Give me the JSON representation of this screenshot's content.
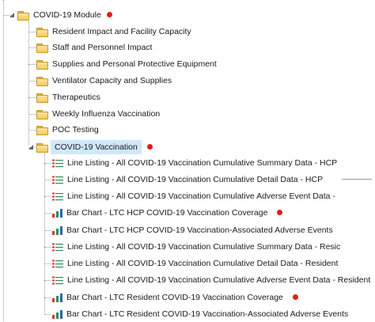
{
  "tree": {
    "module": {
      "label": "COVID-19 Module",
      "has_alert": true
    },
    "folders": [
      {
        "label": "Resident Impact and Facility Capacity"
      },
      {
        "label": "Staff and Personnel Impact"
      },
      {
        "label": "Supplies and Personal Protective Equipment"
      },
      {
        "label": "Ventilator Capacity and Supplies"
      },
      {
        "label": "Therapeutics"
      },
      {
        "label": "Weekly Influenza Vaccination"
      },
      {
        "label": "POC Testing"
      }
    ],
    "vaccination": {
      "label": "COVID-19 Vaccination",
      "has_alert": true,
      "selected": true,
      "reports": [
        {
          "type": "list-icon",
          "label": "Line Listing - All COVID-19 Vaccination Cumulative Summary Data - HCP",
          "has_alert": false
        },
        {
          "type": "list-icon",
          "label": "Line Listing - All COVID-19 Vaccination Cumulative Detail Data - HCP",
          "has_alert": false
        },
        {
          "type": "list-icon",
          "label": "Line Listing - All COVID-19 Vaccination Cumulative Adverse Event Data -",
          "has_alert": false
        },
        {
          "type": "bar-chart-icon",
          "label": "Bar Chart - LTC HCP COVID-19 Vaccination Coverage",
          "has_alert": true
        },
        {
          "type": "bar-chart-icon",
          "label": "Bar Chart - LTC HCP COVID-19 Vaccination-Associated Adverse Events",
          "has_alert": false
        },
        {
          "type": "list-icon",
          "label": "Line Listing - All COVID-19 Vaccination Cumulative Summary Data - Resic",
          "has_alert": false
        },
        {
          "type": "list-icon",
          "label": "Line Listing - All COVID-19 Vaccination Cumulative Detail Data - Resident",
          "has_alert": false
        },
        {
          "type": "list-icon",
          "label": "Line Listing - All COVID-19 Vaccination Cumulative Adverse Event Data - Resident",
          "has_alert": false
        },
        {
          "type": "bar-chart-icon",
          "label": "Bar Chart - LTC Resident COVID-19 Vaccination Coverage",
          "has_alert": true
        },
        {
          "type": "bar-chart-icon",
          "label": "Bar Chart - LTC Resident COVID-19 Vaccination-Associated Adverse Events",
          "has_alert": false
        }
      ]
    }
  },
  "colors": {
    "alert": "#e41b1b",
    "selection": "#cfe8fb",
    "folder": "#f2c85e"
  }
}
